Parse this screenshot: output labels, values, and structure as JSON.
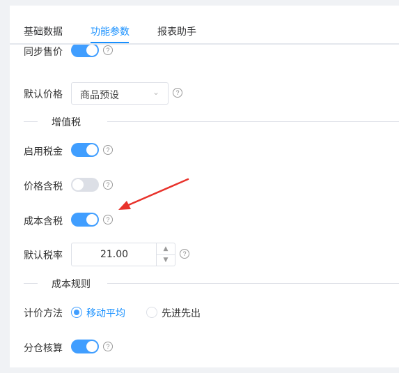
{
  "tabs": [
    {
      "label": "基础数据",
      "active": false
    },
    {
      "label": "功能参数",
      "active": true
    },
    {
      "label": "报表助手",
      "active": false
    }
  ],
  "partial_row": {
    "label": "同步售价",
    "enabled": true
  },
  "default_price": {
    "label": "默认价格",
    "value": "商品预设"
  },
  "vat_section": {
    "title": "增值税"
  },
  "enable_tax": {
    "label": "启用税金",
    "enabled": true
  },
  "price_includes_tax": {
    "label": "价格含税",
    "enabled": false
  },
  "cost_includes_tax": {
    "label": "成本含税",
    "enabled": true
  },
  "default_tax_rate": {
    "label": "默认税率",
    "value": "21.00"
  },
  "cost_rules_section": {
    "title": "成本规则"
  },
  "costing_method": {
    "label": "计价方法",
    "options": [
      {
        "label": "移动平均",
        "selected": true
      },
      {
        "label": "先进先出",
        "selected": false
      }
    ]
  },
  "warehouse_accounting": {
    "label": "分仓核算",
    "enabled": true
  },
  "colors": {
    "accent": "#409eff",
    "annotation": "#e8322b"
  }
}
